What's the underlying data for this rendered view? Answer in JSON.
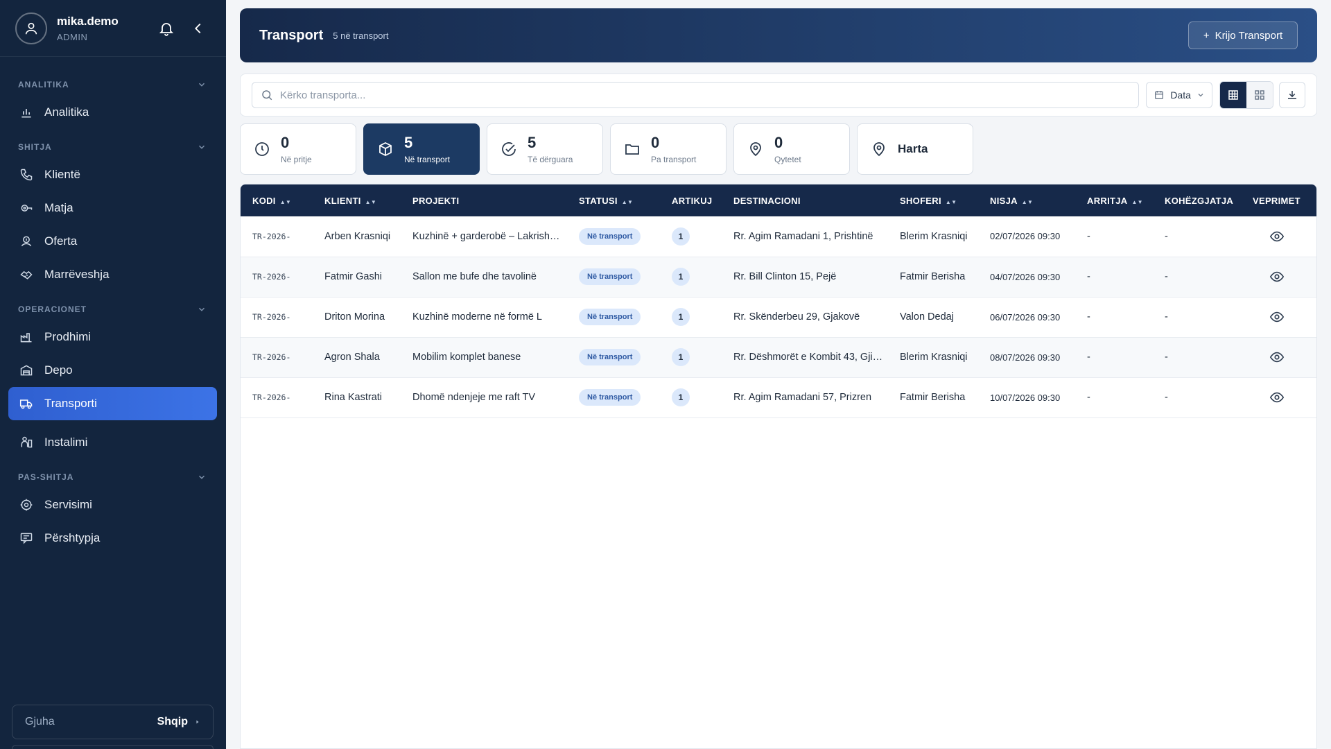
{
  "user": {
    "name": "mika.demo",
    "role": "ADMIN"
  },
  "sidebar": {
    "sections": [
      {
        "title": "ANALITIKA",
        "items": [
          {
            "label": "Analitika",
            "icon": "bar-chart-icon"
          }
        ]
      },
      {
        "title": "SHITJA",
        "items": [
          {
            "label": "Klientë",
            "icon": "phone-icon"
          },
          {
            "label": "Matja",
            "icon": "measure-icon"
          },
          {
            "label": "Oferta",
            "icon": "offer-icon"
          },
          {
            "label": "Marrëveshja",
            "icon": "handshake-icon"
          }
        ]
      },
      {
        "title": "OPERACIONET",
        "items": [
          {
            "label": "Prodhimi",
            "icon": "factory-icon"
          },
          {
            "label": "Depo",
            "icon": "warehouse-icon"
          },
          {
            "label": "Transporti",
            "icon": "truck-icon",
            "active": true
          },
          {
            "label": "Instalimi",
            "icon": "installer-icon"
          }
        ]
      },
      {
        "title": "PAS-SHITJA",
        "items": [
          {
            "label": "Servisimi",
            "icon": "service-icon"
          },
          {
            "label": "Përshtypja",
            "icon": "feedback-icon"
          }
        ]
      }
    ],
    "language": {
      "label": "Gjuha",
      "value": "Shqip"
    }
  },
  "header": {
    "title": "Transport",
    "subtitle": "5 në transport",
    "create_label": "Krijo Transport"
  },
  "toolbar": {
    "search_placeholder": "Kërko transporta...",
    "date_label": "Data"
  },
  "cards": [
    {
      "count": "0",
      "label": "Në pritje",
      "icon": "clock-icon"
    },
    {
      "count": "5",
      "label": "Në transport",
      "icon": "box-icon",
      "active": true
    },
    {
      "count": "5",
      "label": "Të dërguara",
      "icon": "check-circle-icon"
    },
    {
      "count": "0",
      "label": "Pa transport",
      "icon": "folder-icon"
    },
    {
      "count": "0",
      "label": "Qytetet",
      "icon": "pin-icon"
    }
  ],
  "map_card": {
    "label": "Harta",
    "icon": "pin-icon"
  },
  "table": {
    "columns": [
      "KODI",
      "KLIENTI",
      "PROJEKTI",
      "STATUSI",
      "ARTIKUJ",
      "DESTINACIONI",
      "SHOFERI",
      "NISJA",
      "ARRITJA",
      "KOHËZGJATJA",
      "VEPRIMET"
    ],
    "rows": [
      {
        "code": "TR-2026-",
        "client": "Arben Krasniqi",
        "project": "Kuzhinë + garderobë – Lakrish…",
        "status": "Në transport",
        "items": "1",
        "destination": "Rr. Agim Ramadani 1, Prishtinë",
        "driver": "Blerim Krasniqi",
        "departure": "02/07/2026 09:30",
        "arrival": "-",
        "duration": "-"
      },
      {
        "code": "TR-2026-",
        "client": "Fatmir Gashi",
        "project": "Sallon me bufe dhe tavolinë",
        "status": "Në transport",
        "items": "1",
        "destination": "Rr. Bill Clinton 15, Pejë",
        "driver": "Fatmir Berisha",
        "departure": "04/07/2026 09:30",
        "arrival": "-",
        "duration": "-"
      },
      {
        "code": "TR-2026-",
        "client": "Driton Morina",
        "project": "Kuzhinë moderne në formë L",
        "status": "Në transport",
        "items": "1",
        "destination": "Rr. Skënderbeu 29, Gjakovë",
        "driver": "Valon Dedaj",
        "departure": "06/07/2026 09:30",
        "arrival": "-",
        "duration": "-"
      },
      {
        "code": "TR-2026-",
        "client": "Agron Shala",
        "project": "Mobilim komplet banese",
        "status": "Në transport",
        "items": "1",
        "destination": "Rr. Dëshmorët e Kombit 43, Gji…",
        "driver": "Blerim Krasniqi",
        "departure": "08/07/2026 09:30",
        "arrival": "-",
        "duration": "-"
      },
      {
        "code": "TR-2026-",
        "client": "Rina Kastrati",
        "project": "Dhomë ndenjeje me raft TV",
        "status": "Në transport",
        "items": "1",
        "destination": "Rr. Agim Ramadani 57, Prizren",
        "driver": "Fatmir Berisha",
        "departure": "10/07/2026 09:30",
        "arrival": "-",
        "duration": "-"
      }
    ]
  }
}
